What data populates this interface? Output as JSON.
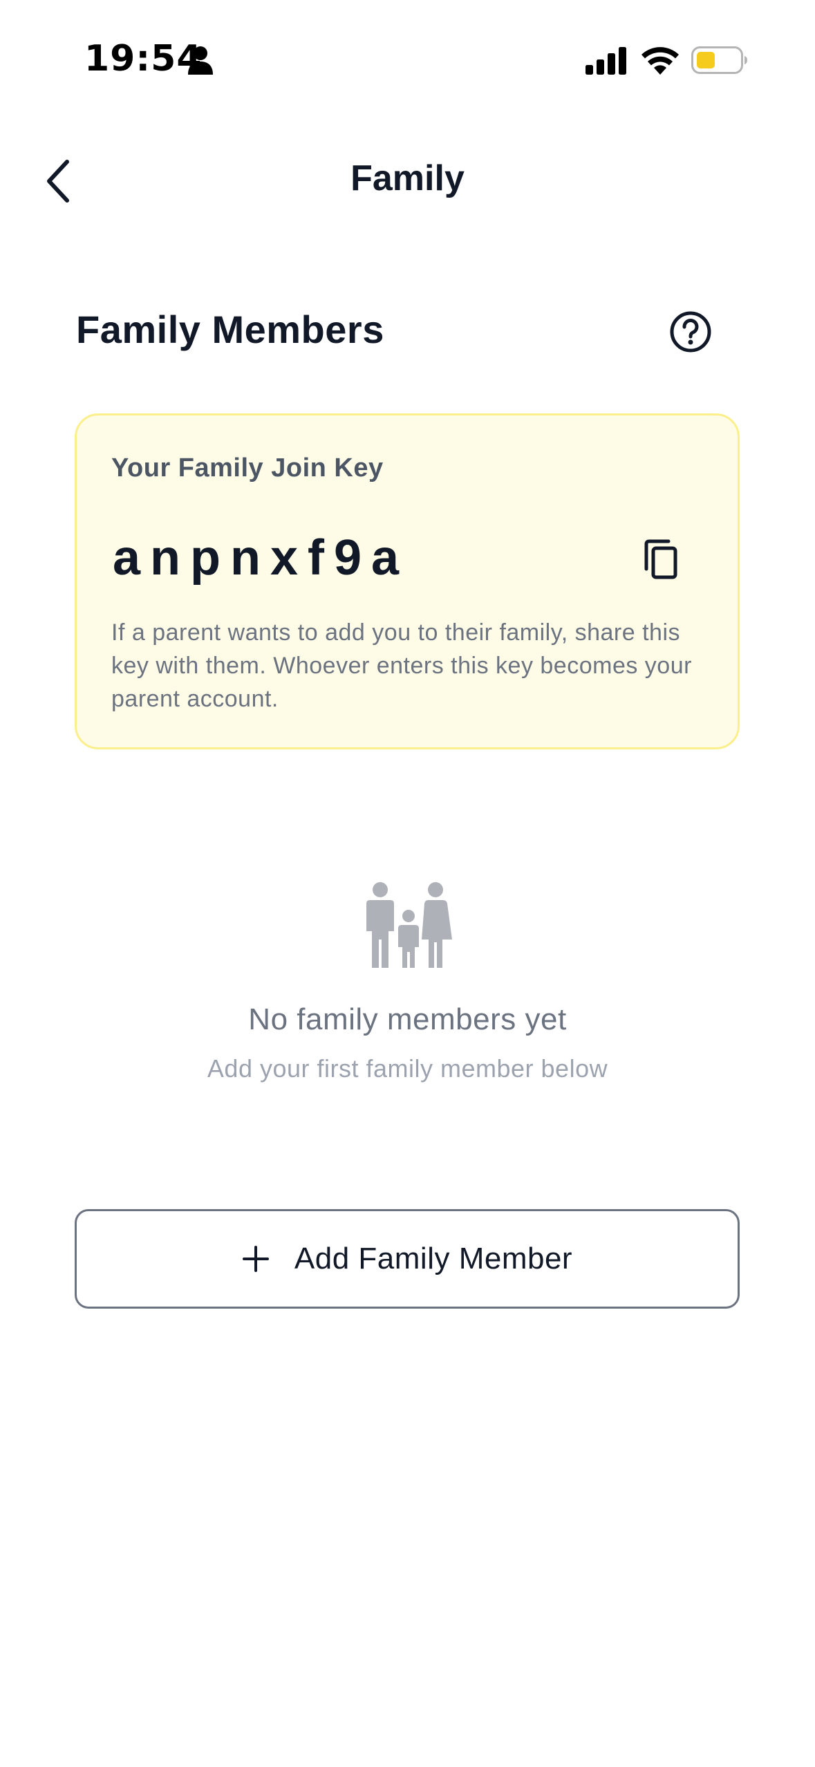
{
  "status_bar": {
    "time": "19:54",
    "battery_color": "#f5cc1d"
  },
  "nav": {
    "title": "Family",
    "back_icon": "chevron-left-icon"
  },
  "section": {
    "title": "Family Members",
    "help_icon": "help-circle-icon"
  },
  "join_key_card": {
    "label": "Your Family Join Key",
    "key": "anpnxf9a",
    "copy_icon": "copy-icon",
    "description": "If a parent wants to add you to their family, share this key with them. Whoever enters this key becomes your parent account.",
    "background_color": "#fefbe6",
    "border_color": "#fbef8c"
  },
  "empty_state": {
    "icon": "family-icon",
    "title": "No family members yet",
    "subtitle": "Add your first family member below"
  },
  "add_button": {
    "icon": "plus-icon",
    "label": "Add Family Member"
  }
}
